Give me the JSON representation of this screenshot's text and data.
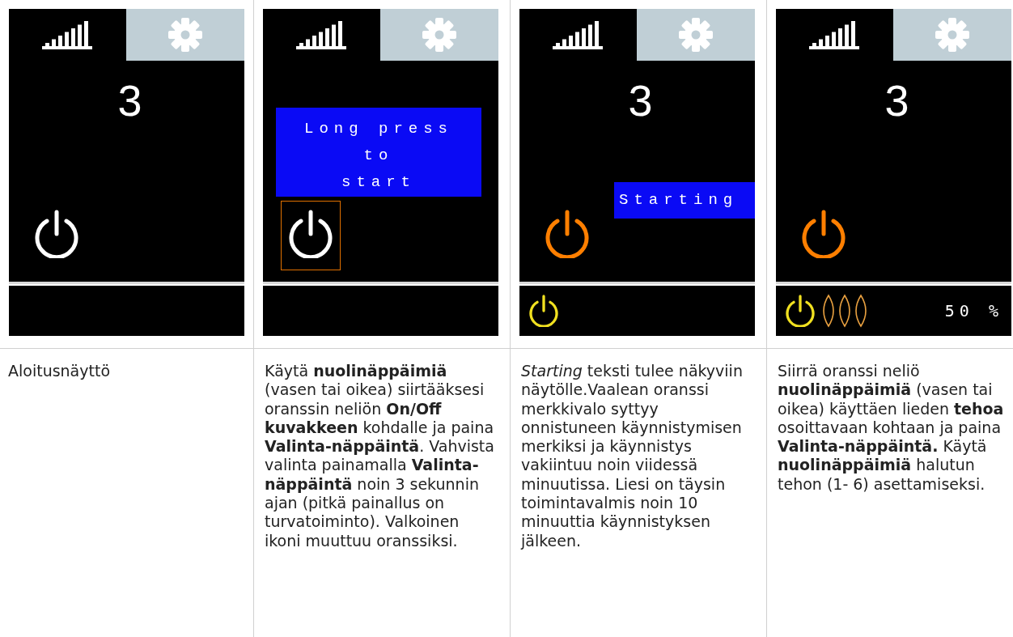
{
  "panels": [
    {
      "screen": {
        "number": "3",
        "power": {
          "on": false,
          "selected": false
        },
        "status": {
          "indicator_on": false,
          "flame_indicator": false
        }
      },
      "description": "Aloitusnäyttö"
    },
    {
      "screen": {
        "power": {
          "on": false,
          "selected": true
        },
        "message": {
          "kind": "banner",
          "text": "Long press\nto\nstart"
        },
        "status": {
          "indicator_on": false,
          "flame_indicator": false
        }
      },
      "description": "Käytä **nuolinäppäimiä** (vasen tai oikea) siirtääksesi oranssin neliön **On/Off kuvakkeen** kohdalle ja paina **Valinta-näppäintä**. Vahvista valinta painamalla **Valinta-näppäintä** noin 3 sekunnin ajan (pitkä painallus on turvatoiminto). Valkoinen ikoni muuttuu oranssiksi."
    },
    {
      "screen": {
        "number": "3",
        "power": {
          "on": true,
          "selected": false
        },
        "message": {
          "kind": "tag",
          "text": "Starting"
        },
        "status": {
          "indicator_on": true,
          "flame_indicator": false
        }
      },
      "description": "*Starting* teksti tulee näkyviin näytölle.Vaalean oranssi merkkivalo syttyy onnistuneen käynnistymisen merkiksi ja käynnistys vakiintuu noin viidessä minuutissa. Liesi on täysin toimintavalmis noin 10 minuuttia käynnistyksen jälkeen."
    },
    {
      "screen": {
        "number": "3",
        "power": {
          "on": true,
          "selected": false
        },
        "status": {
          "indicator_on": true,
          "flame_indicator": true,
          "reading": "50 %"
        }
      },
      "description": "Siirrä oranssi neliö **nuolinäppäimiä** (vasen tai oikea) käyttäen lieden **tehoa** osoittavaan kohtaan ja paina **Valinta-näppäintä.** Käytä **nuolinäppäimiä** halutun tehon (1- 6) asettamiseksi."
    }
  ]
}
